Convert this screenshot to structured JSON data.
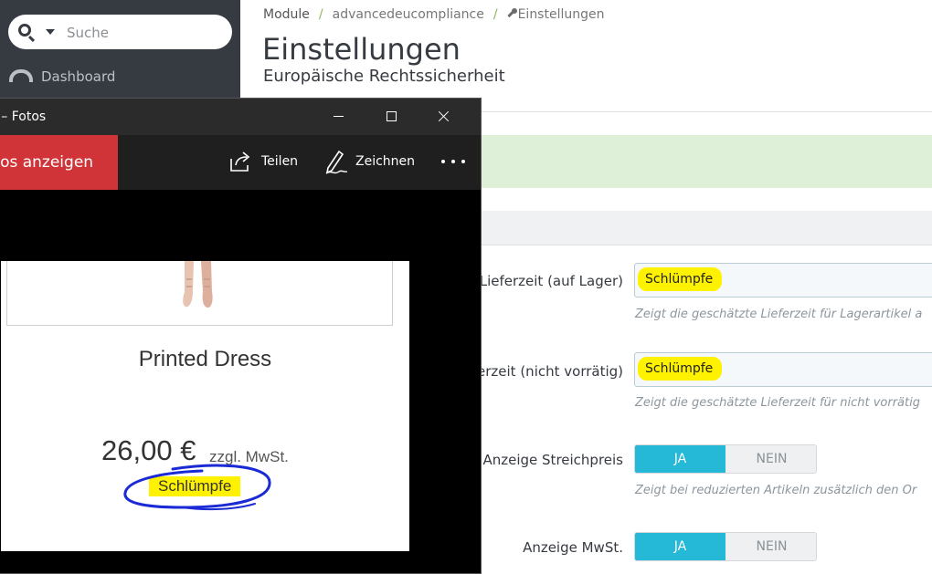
{
  "sidebar": {
    "search": {
      "placeholder": "Suche"
    },
    "items": [
      {
        "label": "Dashboard"
      }
    ]
  },
  "breadcrumb": {
    "items": [
      "Module",
      "advancedeucompliance",
      "Einstellungen"
    ]
  },
  "header": {
    "title": "Einstellungen",
    "subtitle": "Europäische Rechtssicherheit"
  },
  "form": {
    "fields": [
      {
        "label": "Lieferzeit (auf Lager)",
        "value": "Schlümpfe",
        "help": "Zeigt die geschätzte Lieferzeit für Lagerartikel a"
      },
      {
        "label": "erzeit (nicht vorrätig)",
        "value": "Schlümpfe",
        "help": "Zeigt die geschätzte Lieferzeit für nicht vorrätig"
      },
      {
        "label": "Anzeige Streichpreis",
        "yes": "JA",
        "no": "NEIN",
        "selected": "JA",
        "help": "Zeigt bei reduzierten Artikeln zusätzlich den Or"
      },
      {
        "label": "Anzeige MwSt.",
        "yes": "JA",
        "no": "NEIN",
        "selected": "JA"
      }
    ]
  },
  "photos_window": {
    "title": "G – Fotos",
    "toolbar": {
      "view_button": "otos anzeigen",
      "share": "Teilen",
      "draw": "Zeichnen"
    },
    "image": {
      "product_name": "Printed Dress",
      "price": "26,00 €",
      "tax_note": "zzgl. MwSt.",
      "delivery_label": "Schlümpfe"
    }
  },
  "colors": {
    "sidebar": "#363a41",
    "toggle_on": "#25b9d7",
    "highlight": "#fff200",
    "alert_success": "#dff0d8",
    "photos_red": "#d13438",
    "annotation_ink": "#1a2bd6"
  },
  "icons": [
    "search-icon",
    "caret-down-icon",
    "dashboard-icon",
    "wrench-icon",
    "minimize-icon",
    "maximize-icon",
    "close-icon",
    "share-icon",
    "pen-icon",
    "more-icon"
  ]
}
